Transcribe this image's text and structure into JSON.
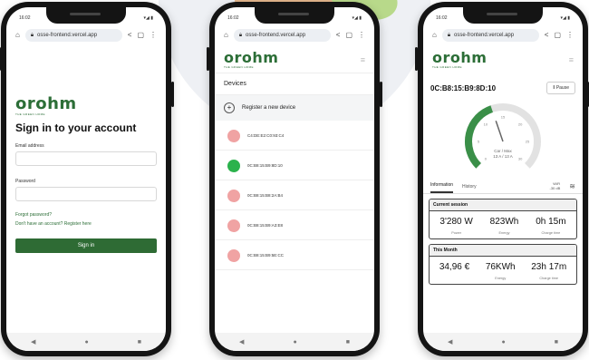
{
  "status_time": "16:02",
  "url": "osse-frontend.vercel.app",
  "brand": {
    "logo": "orohm",
    "tagline": "THE GREEN HOME",
    "color": "#2c6e37"
  },
  "login": {
    "title": "Sign in to your account",
    "email_label": "Email address",
    "password_label": "Password",
    "forgot": "Forgot password?",
    "register": "Don't have an account? Register here",
    "signin": "Sign in"
  },
  "devices": {
    "heading": "Devices",
    "register": "Register a new device",
    "items": [
      {
        "mac": "C4:DE:E2:C0:93:C4",
        "status": "offline"
      },
      {
        "mac": "0C:B8:15:B9:8D:10",
        "status": "online"
      },
      {
        "mac": "0C:B8:15:B8:2A:B4",
        "status": "offline"
      },
      {
        "mac": "0C:B8:15:B9:A3:E8",
        "status": "offline"
      },
      {
        "mac": "0C:B8:15:B9:5E:CC",
        "status": "offline"
      }
    ],
    "status_colors": {
      "online": "#2bb24c",
      "offline": "#f0a3a3"
    }
  },
  "detail": {
    "mac": "0C:B8:15:B9:8D:10",
    "pause": "Pause",
    "gauge_caption": "Car / Max",
    "gauge_value": "13 A / 13 A",
    "gauge_ticks": [
      "0",
      "5",
      "10",
      "15",
      "20",
      "25",
      "30"
    ],
    "gauge_fraction": 0.43,
    "tabs": [
      "Information",
      "History"
    ],
    "wifi_label": "WiFi",
    "wifi_value": "-30 dB",
    "current": {
      "title": "Current session",
      "stats": [
        {
          "value": "3'280 W",
          "label": "Power"
        },
        {
          "value": "823Wh",
          "label": "Energy"
        },
        {
          "value": "0h 15m",
          "label": "Charge time"
        }
      ]
    },
    "month": {
      "title": "This Month",
      "stats": [
        {
          "value": "34,96 €",
          "label": ""
        },
        {
          "value": "76KWh",
          "label": "Energy"
        },
        {
          "value": "23h 17m",
          "label": "Charge time"
        }
      ]
    }
  },
  "nav": {
    "back": "◀",
    "home": "●",
    "recent": "■"
  }
}
